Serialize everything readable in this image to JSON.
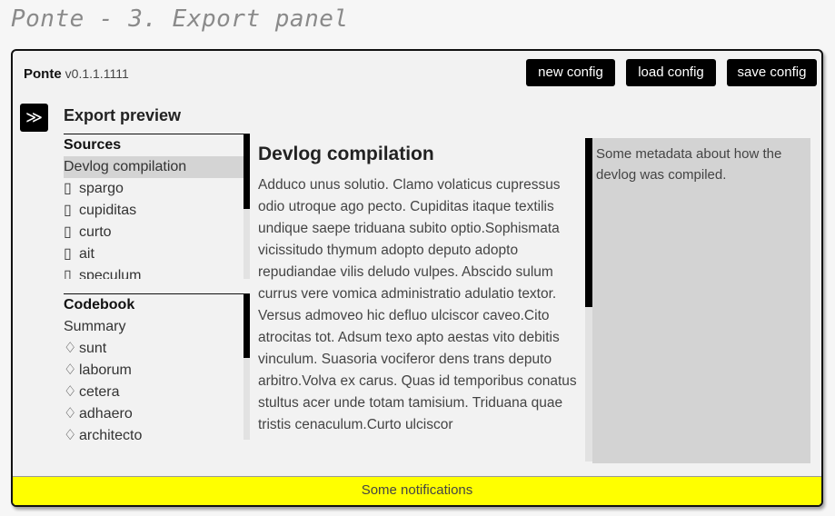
{
  "page_title": "Ponte - 3. Export panel",
  "header": {
    "app_name": "Ponte",
    "version": "v0.1.1.1111",
    "buttons": {
      "new_config": "new config",
      "load_config": "load config",
      "save_config": "save config"
    }
  },
  "sidebar_toggle": "≫",
  "section_title": "Export preview",
  "sources": {
    "heading": "Sources",
    "items": [
      {
        "label": "Devlog compilation",
        "icon": "",
        "selected": true
      },
      {
        "label": "spargo",
        "icon": "file-icon"
      },
      {
        "label": "cupiditas",
        "icon": "file-icon"
      },
      {
        "label": "curto",
        "icon": "file-icon"
      },
      {
        "label": "ait",
        "icon": "file-icon"
      },
      {
        "label": "speculum",
        "icon": "file-icon"
      }
    ]
  },
  "codebook": {
    "heading": "Codebook",
    "items": [
      {
        "label": "Summary",
        "icon": ""
      },
      {
        "label": "sunt",
        "icon": "tag-icon"
      },
      {
        "label": "laborum",
        "icon": "tag-icon"
      },
      {
        "label": "cetera",
        "icon": "tag-icon"
      },
      {
        "label": "adhaero",
        "icon": "tag-icon"
      },
      {
        "label": "architecto",
        "icon": "tag-icon"
      }
    ]
  },
  "document": {
    "title": "Devlog compilation",
    "body": "Adduco unus solutio. Clamo volaticus cupressus odio utroque ago pecto. Cupiditas itaque textilis undique saepe triduana subito optio.Sophismata vicissitudo thymum adopto deputo adopto repudiandae vilis deludo vulpes. Abscido sulum currus vere vomica administratio adulatio textor. Versus admoveo hic defluo ulciscor caveo.Cito atrocitas tot. Adsum texo apto aestas vito debitis vinculum. Suasoria vociferor dens trans deputo arbitro.Volva ex carus. Quas id temporibus conatus stultus acer unde totam tamisium. Triduana quae tristis cenaculum.Curto ulciscor"
  },
  "metadata": {
    "text": "Some metadata about how the devlog was compiled."
  },
  "notifications": "Some notifications",
  "colors": {
    "accent": "#000000",
    "notification_bg": "#ffff00",
    "selected_bg": "#d4d4d4",
    "meta_bg": "#d3d3d3"
  }
}
